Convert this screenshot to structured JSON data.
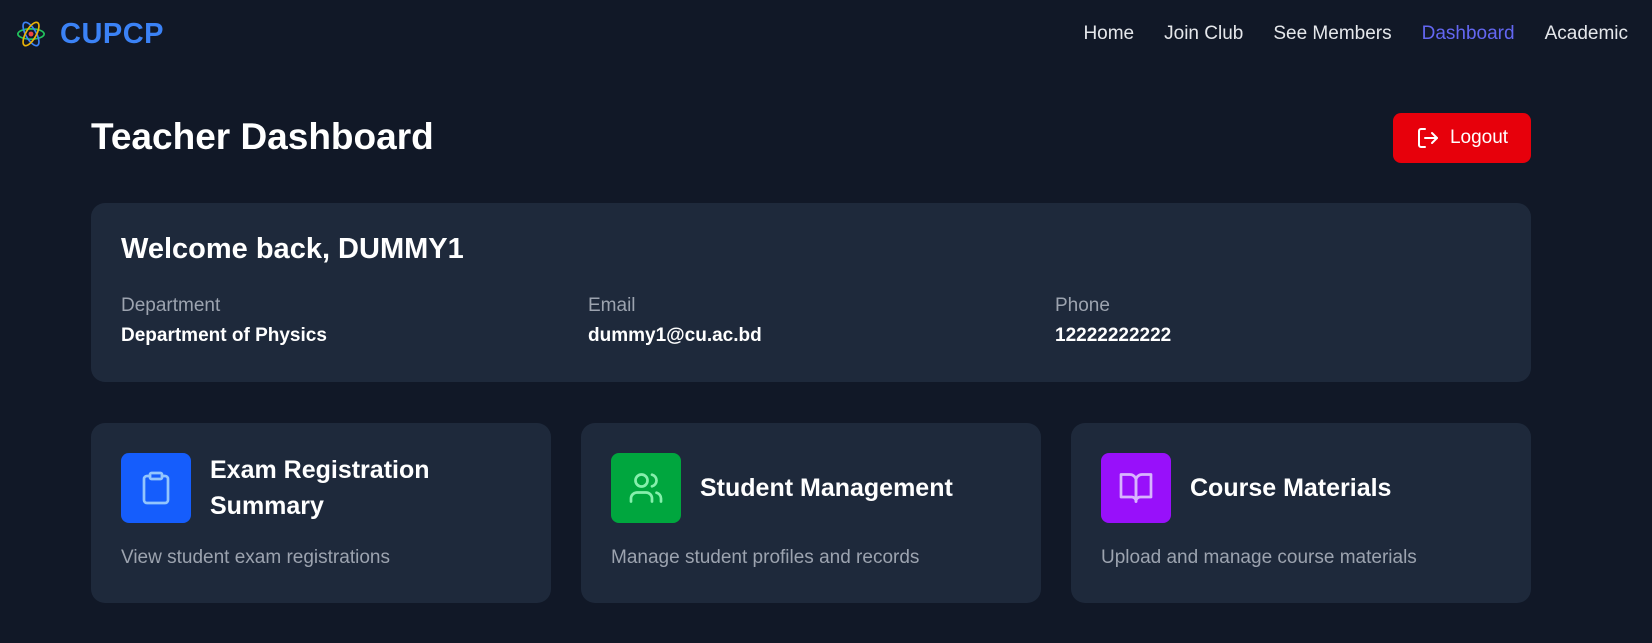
{
  "brand": {
    "name": "CUPCP",
    "logo_icon": "atom-icon"
  },
  "nav": {
    "items": [
      {
        "label": "Home",
        "active": false
      },
      {
        "label": "Join Club",
        "active": false
      },
      {
        "label": "See Members",
        "active": false
      },
      {
        "label": "Dashboard",
        "active": true
      },
      {
        "label": "Academic",
        "active": false
      }
    ]
  },
  "page": {
    "title": "Teacher Dashboard",
    "logout_label": "Logout",
    "logout_icon": "logout-icon"
  },
  "welcome": {
    "title": "Welcome back, DUMMY1",
    "fields": [
      {
        "label": "Department",
        "value": "Department of Physics"
      },
      {
        "label": "Email",
        "value": "dummy1@cu.ac.bd"
      },
      {
        "label": "Phone",
        "value": "12222222222"
      }
    ]
  },
  "cards": [
    {
      "title": "Exam Registration Summary",
      "description": "View student exam registrations",
      "icon": "clipboard-icon",
      "color": "#155dfc"
    },
    {
      "title": "Student Management",
      "description": "Manage student profiles and records",
      "icon": "users-icon",
      "color": "#00a63e"
    },
    {
      "title": "Course Materials",
      "description": "Upload and manage course materials",
      "icon": "book-open-icon",
      "color": "#9810fa"
    }
  ],
  "colors": {
    "background": "#111827",
    "card": "#1e293b",
    "brand": "#3b82f6",
    "nav_active": "#6366f1",
    "logout": "#e7000b"
  }
}
